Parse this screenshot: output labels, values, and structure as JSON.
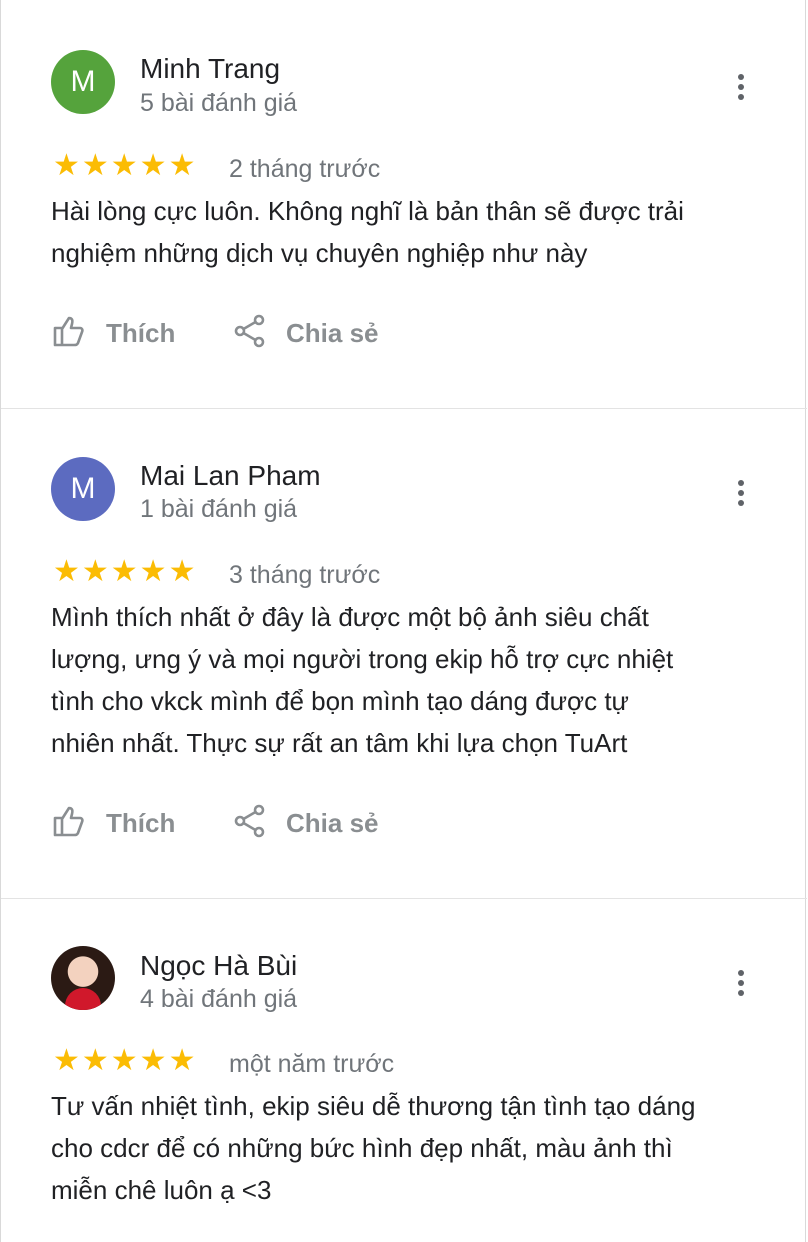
{
  "reviews": [
    {
      "avatar_letter": "M",
      "avatar_color": "#55a33c",
      "name": "Minh Trang",
      "review_count": "5 bài đánh giá",
      "stars": "★★★★★",
      "date": "2 tháng trước",
      "lines": [
        "Hài lòng cực luôn. Không nghĩ là bản thân sẽ được trải",
        "nghiệm những dịch vụ chuyên nghiệp như này"
      ],
      "like_label": "Thích",
      "share_label": "Chia sẻ"
    },
    {
      "avatar_letter": "M",
      "avatar_color": "#5c6bc0",
      "name": "Mai Lan Pham",
      "review_count": "1 bài đánh giá",
      "stars": "★★★★★",
      "date": "3 tháng trước",
      "lines": [
        "Mình thích nhất ở đây là được một bộ ảnh siêu chất",
        "lượng, ưng ý và mọi người trong ekip hỗ trợ cực nhiệt",
        "tình cho vkck mình để bọn mình tạo dáng được tự",
        "nhiên nhất. Thực sự rất an tâm khi lựa chọn TuArt"
      ],
      "like_label": "Thích",
      "share_label": "Chia sẻ"
    },
    {
      "avatar_letter": "",
      "avatar_color": "#2b1a14",
      "name": "Ngọc Hà Bùi",
      "review_count": "4 bài đánh giá",
      "stars": "★★★★★",
      "date": "một năm trước",
      "lines": [
        "Tư vấn nhiệt tình, ekip siêu dễ thương tận tình tạo dáng",
        "cho cdcr để có những bức hình đẹp nhất, màu ảnh thì",
        "miễn chê luôn ạ <3"
      ]
    }
  ],
  "icons": {
    "like": "thumbs-up-icon",
    "share": "share-icon",
    "more": "more-vert-icon"
  }
}
